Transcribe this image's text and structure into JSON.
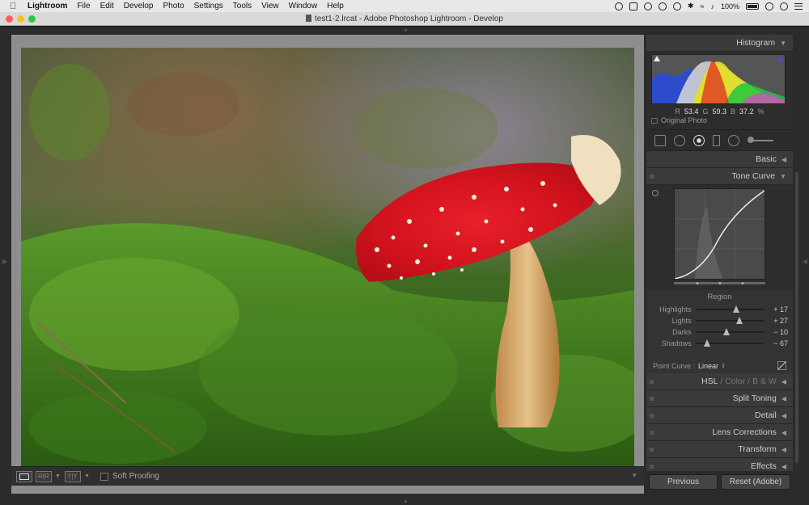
{
  "menubar": {
    "apple": "",
    "items": [
      "Lightroom",
      "File",
      "Edit",
      "Develop",
      "Photo",
      "Settings",
      "Tools",
      "View",
      "Window",
      "Help"
    ],
    "battery": "100%",
    "status_icons": [
      "creative-cloud-icon",
      "shield-icon",
      "cloud-icon",
      "user-icon",
      "time-machine-icon",
      "bluetooth-icon",
      "wifi-icon",
      "volume-icon",
      "battery-icon",
      "clock-icon",
      "spotlight-icon",
      "menu-lines-icon"
    ]
  },
  "window": {
    "title": "test1-2.lrcat - Adobe Photoshop Lightroom - Develop"
  },
  "histogram": {
    "title": "Histogram",
    "r_label": "R",
    "r_value": "53.4",
    "g_label": "G",
    "g_value": "59.3",
    "b_label": "B",
    "b_value": "37.2",
    "percent": "%",
    "original_photo": "Original Photo"
  },
  "panels": {
    "basic": "Basic",
    "tone_curve": "Tone Curve",
    "region_title": "Region",
    "point_curve_label": "Point Curve :",
    "point_curve_value": "Linear",
    "hsl": "HSL",
    "color": "Color",
    "bw": "B & W",
    "hsl_sep": "/",
    "split_toning": "Split Toning",
    "detail": "Detail",
    "lens_corrections": "Lens Corrections",
    "transform": "Transform",
    "effects": "Effects"
  },
  "region_sliders": [
    {
      "label": "Highlights",
      "value": "+ 17",
      "level": 17
    },
    {
      "label": "Lights",
      "value": "+ 27",
      "level": 27
    },
    {
      "label": "Darks",
      "value": "− 10",
      "level": -10
    },
    {
      "label": "Shadows",
      "value": "− 67",
      "level": -67
    }
  ],
  "toolbar": {
    "loupe_label": "",
    "compare_label": "R|R",
    "survey_label": "Y|Y",
    "soft_proofing": "Soft Proofing"
  },
  "buttons": {
    "previous": "Previous",
    "reset": "Reset (Adobe)"
  },
  "colors": {
    "panel_bg": "#333333",
    "background": "#2b2b2b",
    "photo_frame": "#8e8e8e"
  }
}
